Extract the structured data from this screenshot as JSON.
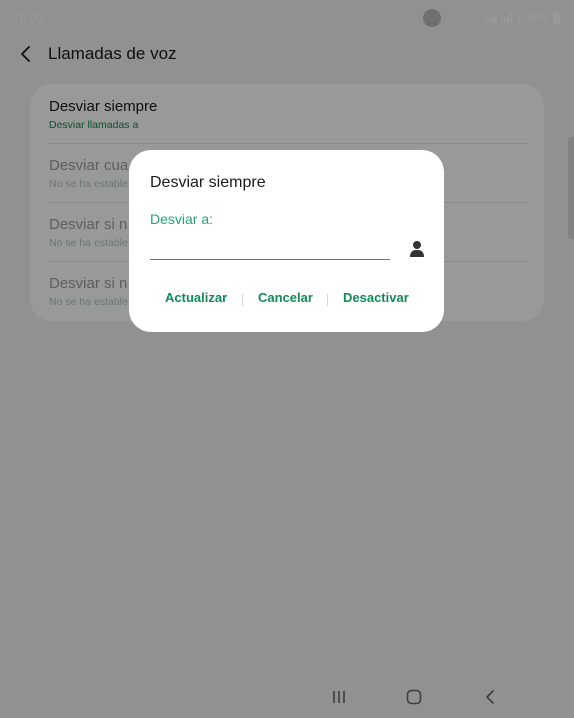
{
  "status_bar": {
    "time": "10:00",
    "battery": "100%"
  },
  "header": {
    "back_icon": "back-icon",
    "title": "Llamadas de voz"
  },
  "settings": {
    "items": [
      {
        "title": "Desviar siempre",
        "subtitle": "Desviar llamadas a",
        "state": "active"
      },
      {
        "title": "Desviar cua",
        "subtitle": "No se ha estable",
        "state": "disabled"
      },
      {
        "title": "Desviar si n",
        "subtitle": "No se ha estable",
        "state": "disabled"
      },
      {
        "title": "Desviar si n",
        "subtitle": "No se ha estable",
        "state": "disabled"
      }
    ]
  },
  "dialog": {
    "title": "Desviar siempre",
    "field_label": "Desviar a:",
    "field_value": "",
    "contact_icon": "contact-person-icon",
    "actions": {
      "update": "Actualizar",
      "cancel": "Cancelar",
      "deactivate": "Desactivar"
    }
  },
  "nav_bar": {
    "icons": [
      "recents-icon",
      "home-icon",
      "back-icon"
    ]
  },
  "colors": {
    "accent": "#1ea570",
    "accent_dark": "#138a56",
    "background": "#f2f2f2",
    "overlay": "rgba(0,0,0,0.40)"
  }
}
